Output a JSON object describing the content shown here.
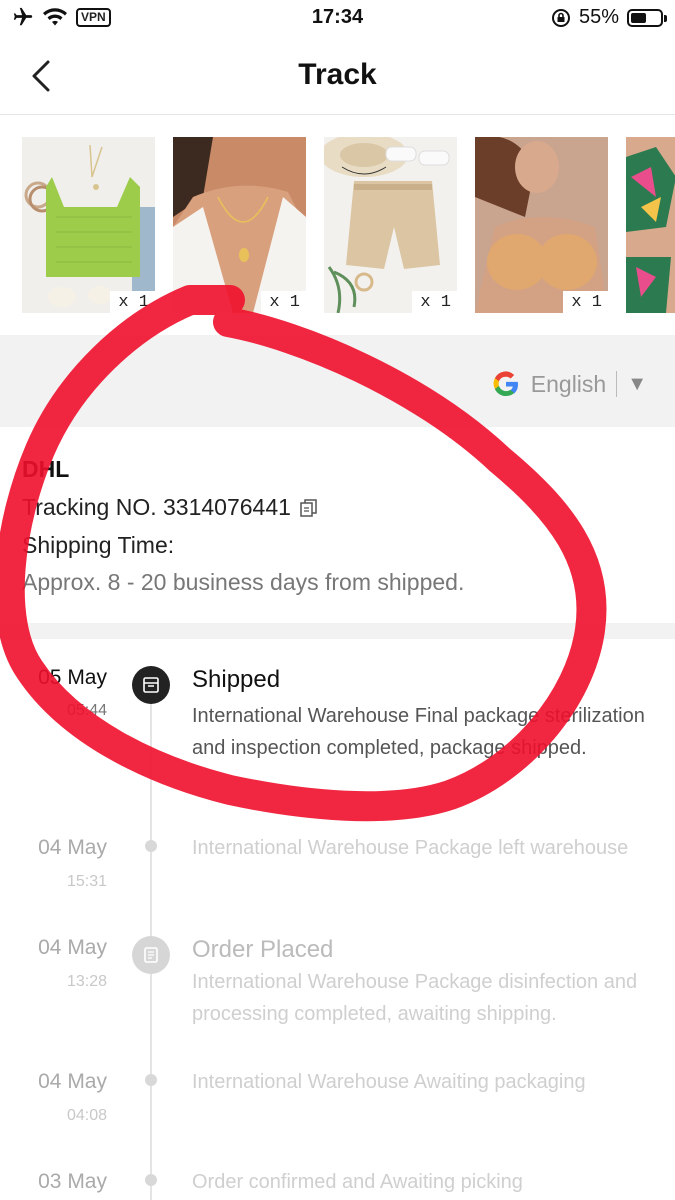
{
  "status_bar": {
    "time": "17:34",
    "vpn_label": "VPN",
    "battery_percent": "55%",
    "battery_level": 0.55,
    "icons": [
      "airplane-icon",
      "wifi-icon",
      "orientation-lock-icon",
      "battery-icon"
    ]
  },
  "header": {
    "title": "Track",
    "back_icon": "chevron-left-icon"
  },
  "products": [
    {
      "qty": "x 1",
      "desc": "green-crop-top"
    },
    {
      "qty": "x 1",
      "desc": "gold-necklace"
    },
    {
      "qty": "x 1",
      "desc": "beige-shorts"
    },
    {
      "qty": "x 1",
      "desc": "adhesive-bra"
    },
    {
      "qty": "",
      "desc": "floral-bikini"
    }
  ],
  "language": {
    "label": "English",
    "icon": "google-icon"
  },
  "shipment": {
    "carrier": "DHL",
    "tracking_label": "Tracking NO. 3314076441",
    "shipping_time_label": "Shipping Time:",
    "shipping_time_value": "Approx. 8 - 20 business days from shipped."
  },
  "events": [
    {
      "date": "05 May",
      "time": "05:44",
      "title": "Shipped",
      "desc": "International Warehouse Final package sterilization and inspection completed, package shipped."
    },
    {
      "date": "04 May",
      "time": "15:31",
      "title": "",
      "desc": "International Warehouse Package left warehouse"
    },
    {
      "date": "04 May",
      "time": "13:28",
      "title": "Order Placed",
      "desc": "International Warehouse Package disinfection and processing completed, awaiting shipping."
    },
    {
      "date": "04 May",
      "time": "04:08",
      "title": "",
      "desc": "International Warehouse Awaiting packaging"
    },
    {
      "date": "03 May",
      "time": "",
      "title": "",
      "desc": "Order confirmed and Awaiting picking"
    }
  ],
  "colors": {
    "annotation_red": "#f0102c",
    "active_node": "#222222",
    "faded_node": "#d8d8d8"
  }
}
